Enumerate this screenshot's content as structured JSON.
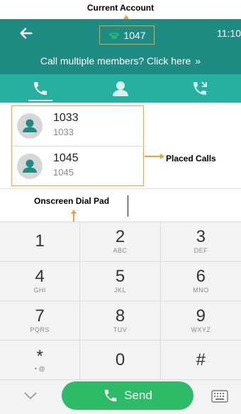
{
  "annotations": {
    "current_account": "Current Account",
    "placed_calls": "Placed Calls",
    "onscreen_dial_pad": "Onscreen Dial Pad"
  },
  "header": {
    "account": "1047",
    "time": "11:10"
  },
  "banner": {
    "text": "Call multiple members? Click here",
    "chevron": "»"
  },
  "tabs": [
    {
      "name": "history",
      "icon": "phone-icon"
    },
    {
      "name": "directory",
      "icon": "contact-icon"
    },
    {
      "name": "transfer",
      "icon": "call-transfer-icon"
    }
  ],
  "placed_calls": [
    {
      "name": "1033",
      "number": "1033"
    },
    {
      "name": "1045",
      "number": "1045"
    }
  ],
  "dialpad": {
    "keys": [
      {
        "digit": "1",
        "letters": ""
      },
      {
        "digit": "2",
        "letters": "ABC"
      },
      {
        "digit": "3",
        "letters": "DEF"
      },
      {
        "digit": "4",
        "letters": "GHI"
      },
      {
        "digit": "5",
        "letters": "JKL"
      },
      {
        "digit": "6",
        "letters": "MNO"
      },
      {
        "digit": "7",
        "letters": "PQRS"
      },
      {
        "digit": "8",
        "letters": "TUV"
      },
      {
        "digit": "9",
        "letters": "WXYZ"
      },
      {
        "digit": "*",
        "letters": "• @"
      },
      {
        "digit": "0",
        "letters": ""
      },
      {
        "digit": "#",
        "letters": ""
      }
    ]
  },
  "footer": {
    "send_label": "Send"
  },
  "colors": {
    "header": "#1f8c84",
    "tabs": "#25b09f",
    "annotation": "#e8a33a",
    "send": "#2dbb68",
    "account_phone": "#2dbb68"
  }
}
